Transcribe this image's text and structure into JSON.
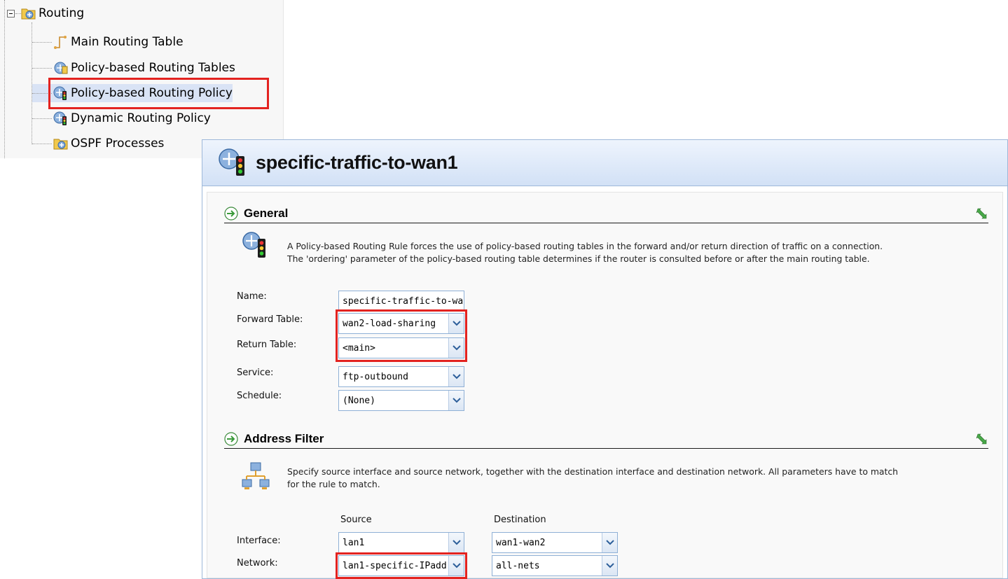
{
  "tree": {
    "root_label": "Routing",
    "items": [
      {
        "label": "Main Routing Table",
        "icon": "route-icon"
      },
      {
        "label": "Policy-based Routing Tables",
        "icon": "routing-tables-icon"
      },
      {
        "label": "Policy-based Routing Policy",
        "icon": "traffic-light-icon",
        "selected": true
      },
      {
        "label": "Dynamic Routing Policy",
        "icon": "traffic-light-icon"
      },
      {
        "label": "OSPF Processes",
        "icon": "folder-icon"
      }
    ]
  },
  "panel": {
    "title": "specific-traffic-to-wan1",
    "general": {
      "title": "General",
      "description_line1": "A Policy-based Routing Rule forces the use of policy-based routing tables in the forward and/or return direction of traffic on a connection.",
      "description_line2": "The 'ordering' parameter of the policy-based routing table determines if the router is consulted before or after the main routing table.",
      "fields": {
        "name": {
          "label": "Name:",
          "value": "specific-traffic-to-wan:"
        },
        "forward_table": {
          "label": "Forward Table:",
          "value": "wan2-load-sharing"
        },
        "return_table": {
          "label": "Return Table:",
          "value": "<main>"
        },
        "service": {
          "label": "Service:",
          "value": "ftp-outbound"
        },
        "schedule": {
          "label": "Schedule:",
          "value": "(None)"
        }
      }
    },
    "address_filter": {
      "title": "Address Filter",
      "description_line1": "Specify source interface and source network, together with the destination interface and destination network. All parameters have to match",
      "description_line2": "for the rule to match.",
      "source_heading": "Source",
      "destination_heading": "Destination",
      "interface": {
        "label": "Interface:",
        "source": "lan1",
        "destination": "wan1-wan2"
      },
      "network": {
        "label": "Network:",
        "source": "lan1-specific-IPadd",
        "destination": "all-nets"
      }
    }
  },
  "colors": {
    "highlight": "#e32320",
    "header_gradient_top": "#eef4fd",
    "header_gradient_bottom": "#d2e1f6",
    "field_border": "#8fb0d6",
    "collapse_arrow": "#3a9a3a"
  }
}
